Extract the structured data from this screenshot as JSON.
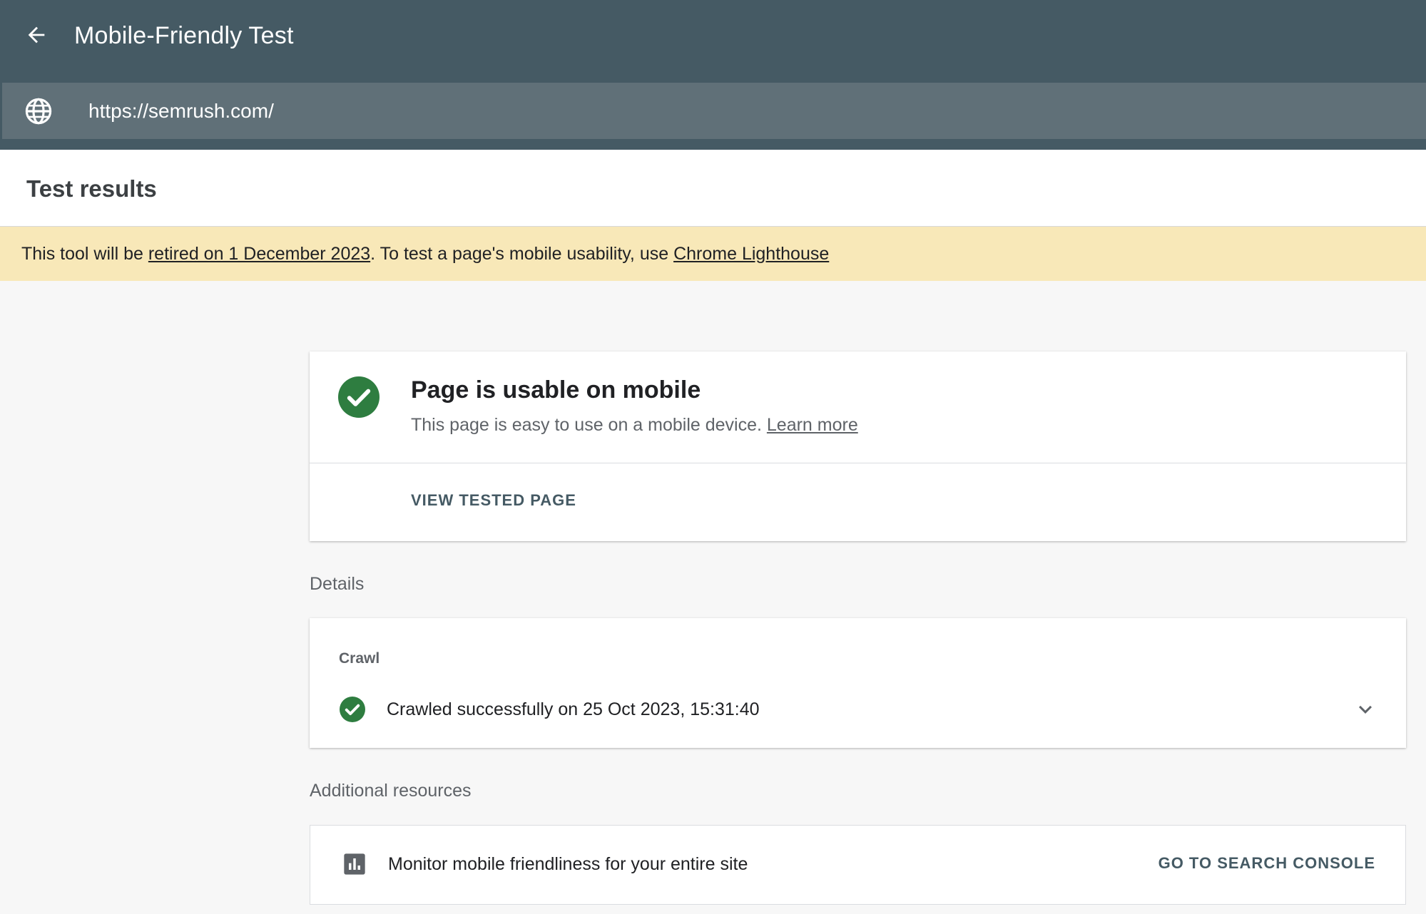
{
  "header": {
    "title": "Mobile-Friendly Test",
    "back_icon": "arrow-back-icon"
  },
  "url_bar": {
    "icon": "globe-icon",
    "value": "https://semrush.com/"
  },
  "results": {
    "title": "Test results"
  },
  "banner": {
    "text_before": "This tool will be ",
    "link1": "retired on 1 December 2023",
    "text_middle": ". To test a page's mobile usability, use ",
    "link2": "Chrome Lighthouse"
  },
  "status": {
    "heading": "Page is usable on mobile",
    "description": "This page is easy to use on a mobile device. ",
    "learn_more": "Learn more",
    "view_button": "VIEW TESTED PAGE"
  },
  "details": {
    "label": "Details",
    "crawl_label": "Crawl",
    "crawl_status": "Crawled successfully on 25 Oct 2023, 15:31:40"
  },
  "resources": {
    "label": "Additional resources",
    "item_text": "Monitor mobile friendliness for your entire site",
    "item_button": "GO TO SEARCH CONSOLE"
  },
  "colors": {
    "header_bg": "#455a64",
    "url_bar_bg": "#607078",
    "banner_bg": "#f8e8b8",
    "success_green": "#2e7d40",
    "page_bg": "#f7f7f7"
  }
}
